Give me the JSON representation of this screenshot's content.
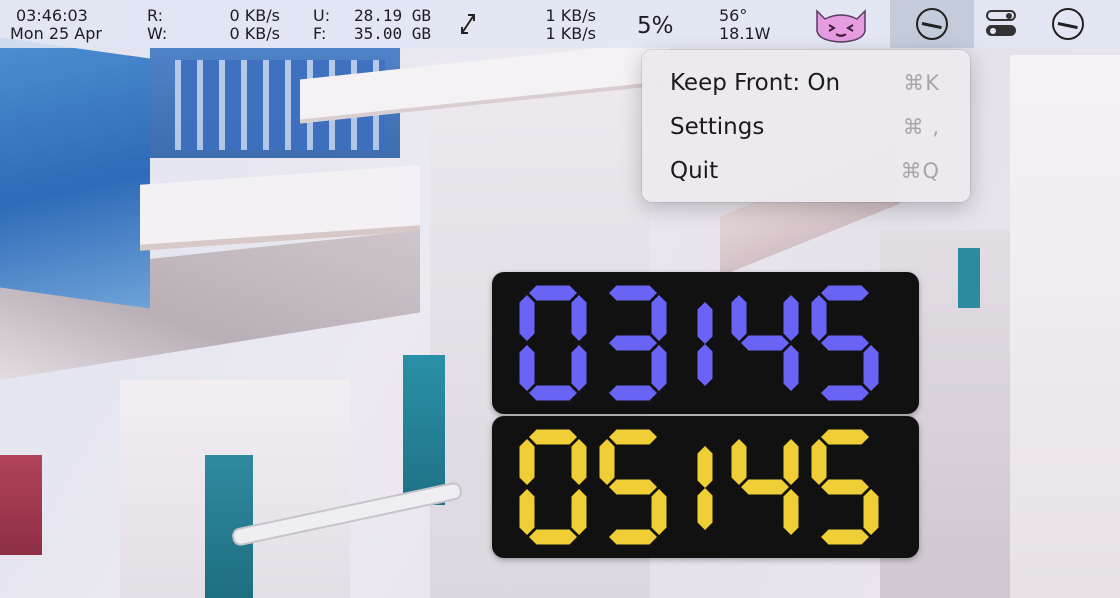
{
  "menubar": {
    "clock": {
      "time": "03:46:03",
      "date": "Mon 25 Apr"
    },
    "disk_io": {
      "read_label": "R:",
      "write_label": "W:",
      "read_rate": "0 KB/s",
      "write_rate": "0 KB/s"
    },
    "storage": {
      "used_label": "U:",
      "free_label": "F:",
      "used_value": "28.19 GB",
      "free_value": "35.00 GB"
    },
    "network": {
      "icon": "network-arrows-icon",
      "upload_rate": "1 KB/s",
      "download_rate": "1 KB/s"
    },
    "cpu": {
      "percent": "5%"
    },
    "sensors": {
      "temperature": "56°",
      "power": "18.1W"
    },
    "icons": [
      "mascot-icon",
      "clock-icon",
      "control-center-icon",
      "clock-icon"
    ]
  },
  "context_menu": {
    "items": [
      {
        "label": "Keep Front: On",
        "shortcut": "⌘K"
      },
      {
        "label": "Settings",
        "shortcut": "⌘ ,"
      },
      {
        "label": "Quit",
        "shortcut": "⌘Q"
      }
    ]
  },
  "clocks": [
    {
      "time": "03:45",
      "color": "#6a64f6"
    },
    {
      "time": "05:45",
      "color": "#efcf35"
    }
  ],
  "colors": {
    "panel_bg": "#111112",
    "menubar_bg": "#e1e6f4",
    "menu_bg": "#ece9ee",
    "shortcut_text": "#a8a6ac"
  }
}
